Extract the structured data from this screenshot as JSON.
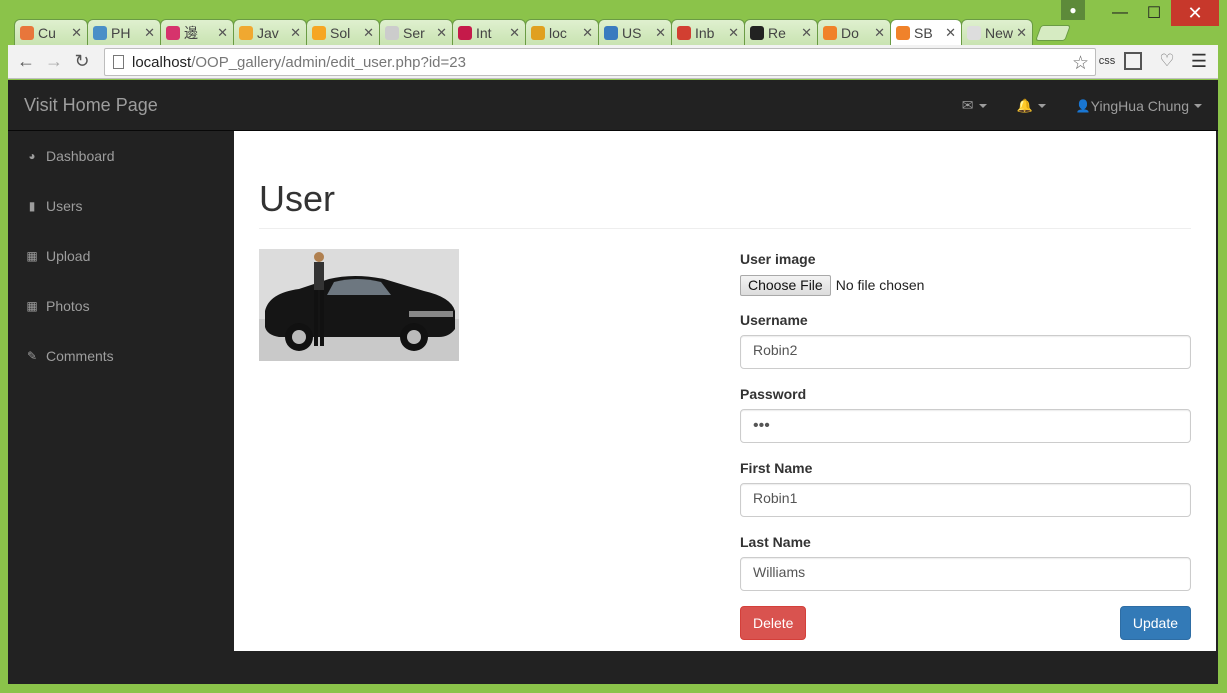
{
  "browser": {
    "tabs": [
      {
        "title": "Cu",
        "fav_color": "#e8763b"
      },
      {
        "title": "PH",
        "fav_color": "#4a8fc7"
      },
      {
        "title": "邊",
        "fav_color": "#d6336c"
      },
      {
        "title": "Jav",
        "fav_color": "#f0a830"
      },
      {
        "title": "Sol",
        "fav_color": "#f6a623"
      },
      {
        "title": "Ser",
        "fav_color": "#cccccc"
      },
      {
        "title": "Int",
        "fav_color": "#c51a4a"
      },
      {
        "title": "loc",
        "fav_color": "#e0a020"
      },
      {
        "title": "US",
        "fav_color": "#3a7bbf"
      },
      {
        "title": "Inb",
        "fav_color": "#d23f31"
      },
      {
        "title": "Re",
        "fav_color": "#222222"
      },
      {
        "title": "Do",
        "fav_color": "#f0822a"
      },
      {
        "title": "SB",
        "fav_color": "#f0822a"
      },
      {
        "title": "New",
        "fav_color": "#dddddd"
      }
    ],
    "url_host": "localhost",
    "url_path": "/OOP_gallery/admin/edit_user.php?id=23",
    "ext_css_label": "css"
  },
  "navbar": {
    "brand": "Visit Home Page",
    "user_name": "YingHua Chung"
  },
  "sidebar": {
    "items": [
      {
        "label": "Dashboard",
        "icon": "dashboard-icon"
      },
      {
        "label": "Users",
        "icon": "bar-chart-icon"
      },
      {
        "label": "Upload",
        "icon": "table-icon"
      },
      {
        "label": "Photos",
        "icon": "table-icon"
      },
      {
        "label": "Comments",
        "icon": "edit-icon"
      }
    ]
  },
  "main": {
    "title": "User",
    "form": {
      "image_label": "User image",
      "file_button": "Choose File",
      "file_status": "No file chosen",
      "username_label": "Username",
      "username_value": "Robin2",
      "password_label": "Password",
      "password_value": "•••",
      "first_name_label": "First Name",
      "first_name_value": "Robin1",
      "last_name_label": "Last Name",
      "last_name_value": "Williams",
      "delete_label": "Delete",
      "update_label": "Update"
    }
  },
  "colors": {
    "navbar_bg": "#222222",
    "danger": "#d9534f",
    "primary": "#337ab7",
    "window_frame": "#8bc34a"
  }
}
